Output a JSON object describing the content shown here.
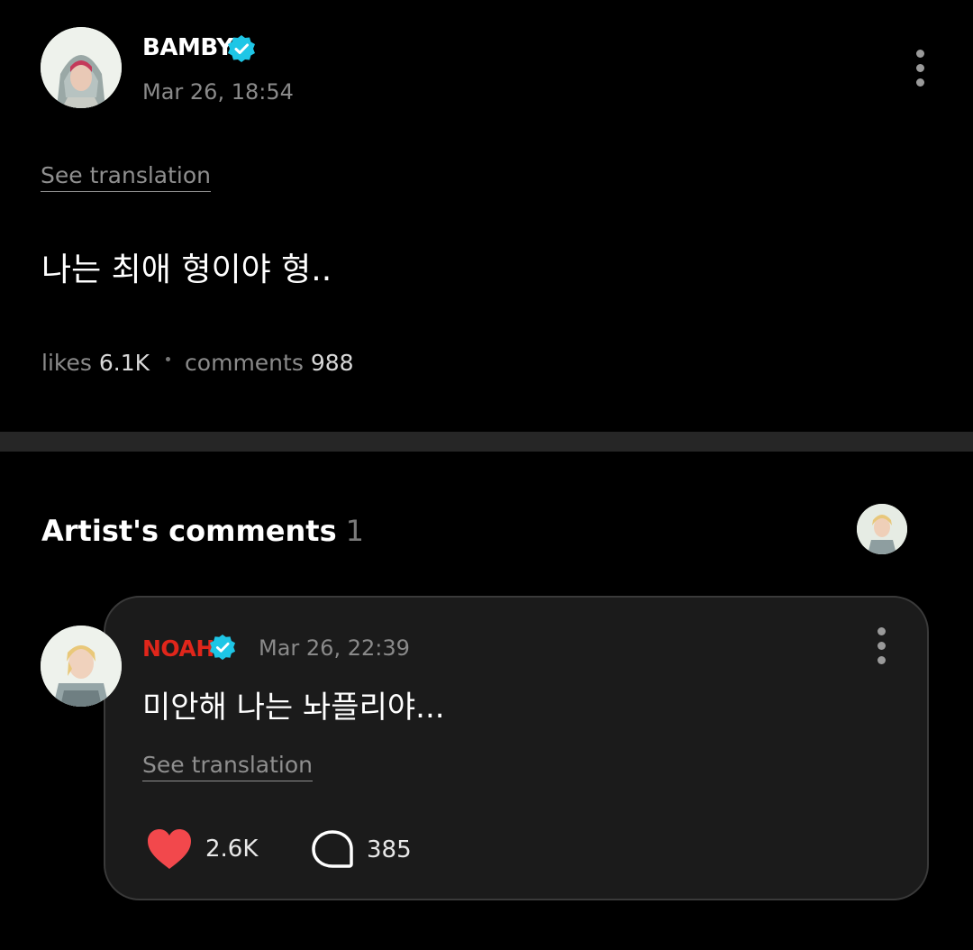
{
  "post": {
    "author": "BAMBY",
    "timestamp": "Mar 26, 18:54",
    "see_translation": "See translation",
    "body": "나는 최애 형이야 형..",
    "stats": {
      "likes_label": "likes",
      "likes_value": "6.1K",
      "comments_label": "comments",
      "comments_value": "988"
    }
  },
  "artist_comments": {
    "title": "Artist's comments",
    "count": "1",
    "comment": {
      "author": "NOAH",
      "timestamp": "Mar 26, 22:39",
      "body": "미안해 나는 놔플리야...",
      "see_translation": "See translation",
      "likes": "2.6K",
      "replies": "385"
    }
  },
  "colors": {
    "verified": "#1ec6e6",
    "artist_name": "#e0261b",
    "heart": "#f2484c"
  },
  "icons": [
    "verified-badge-icon",
    "more-options-icon",
    "heart-icon",
    "comment-bubble-icon"
  ]
}
